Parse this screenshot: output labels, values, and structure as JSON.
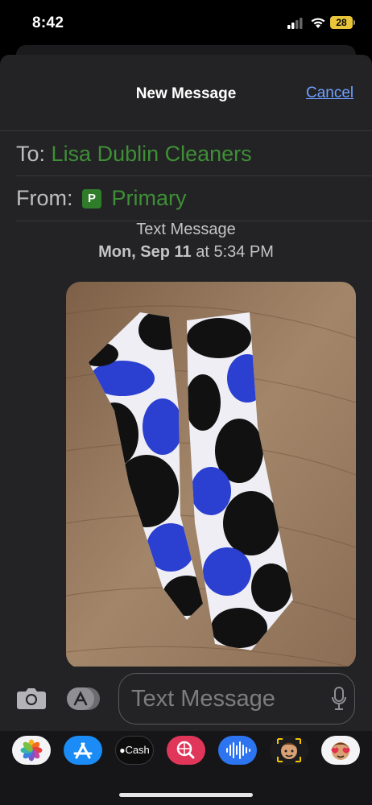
{
  "status_bar": {
    "time": "8:42",
    "battery": "28"
  },
  "header": {
    "title": "New Message",
    "cancel_label": "Cancel"
  },
  "recipients": {
    "to_label": "To:",
    "to_name": "Lisa Dublin Cleaners",
    "from_label": "From:",
    "from_badge": "P",
    "from_line": "Primary"
  },
  "conversation": {
    "service": "Text Message",
    "date": "Mon, Sep 11",
    "at": " at ",
    "time": "5:34 PM"
  },
  "compose": {
    "placeholder": "Text Message"
  },
  "app_drawer": {
    "items": [
      {
        "icon": "photos-icon"
      },
      {
        "icon": "app-store-icon"
      },
      {
        "icon": "apple-cash-icon",
        "label": "Cash"
      },
      {
        "icon": "web-search-icon"
      },
      {
        "icon": "audio-message-icon"
      },
      {
        "icon": "memoji-icon"
      },
      {
        "icon": "memoji-stickers-icon"
      }
    ]
  },
  "colors": {
    "accent_link": "#6ea0ff",
    "recipient_green": "#3e8f36",
    "sheet_bg": "#232325"
  }
}
